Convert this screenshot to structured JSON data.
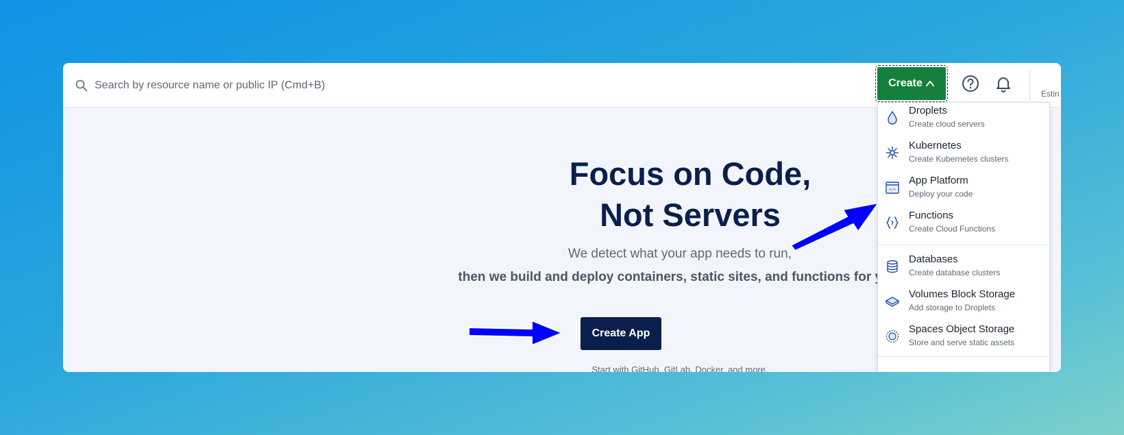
{
  "search": {
    "placeholder": "Search by resource name or public IP (Cmd+B)"
  },
  "header": {
    "create_label": "Create",
    "estimate_text": "Estin"
  },
  "hero": {
    "title_line1": "Focus on Code,",
    "title_line2": "Not Servers",
    "line1": "We detect what your app needs to run,",
    "line2": "then we build and deploy containers, static sites, and functions for you.",
    "button_label": "Create App",
    "subtext": "Start with GitHub, GitLab, Docker, and more."
  },
  "menu": {
    "items": [
      {
        "label": "Droplets",
        "sub": "Create cloud servers",
        "icon": "droplet-icon"
      },
      {
        "label": "Kubernetes",
        "sub": "Create Kubernetes clusters",
        "icon": "kubernetes-icon"
      },
      {
        "label": "App Platform",
        "sub": "Deploy your code",
        "icon": "app-platform-icon"
      },
      {
        "label": "Functions",
        "sub": "Create Cloud Functions",
        "icon": "functions-icon"
      },
      {
        "label": "Databases",
        "sub": "Create database clusters",
        "icon": "database-icon"
      },
      {
        "label": "Volumes Block Storage",
        "sub": "Add storage to Droplets",
        "icon": "volume-icon"
      },
      {
        "label": "Spaces Object Storage",
        "sub": "Store and serve static assets",
        "icon": "spaces-icon"
      }
    ]
  },
  "colors": {
    "create_button": "#15803d",
    "navy": "#0b1f4d",
    "arrow": "#0000ff",
    "icon_blue": "#1f4fa8"
  }
}
